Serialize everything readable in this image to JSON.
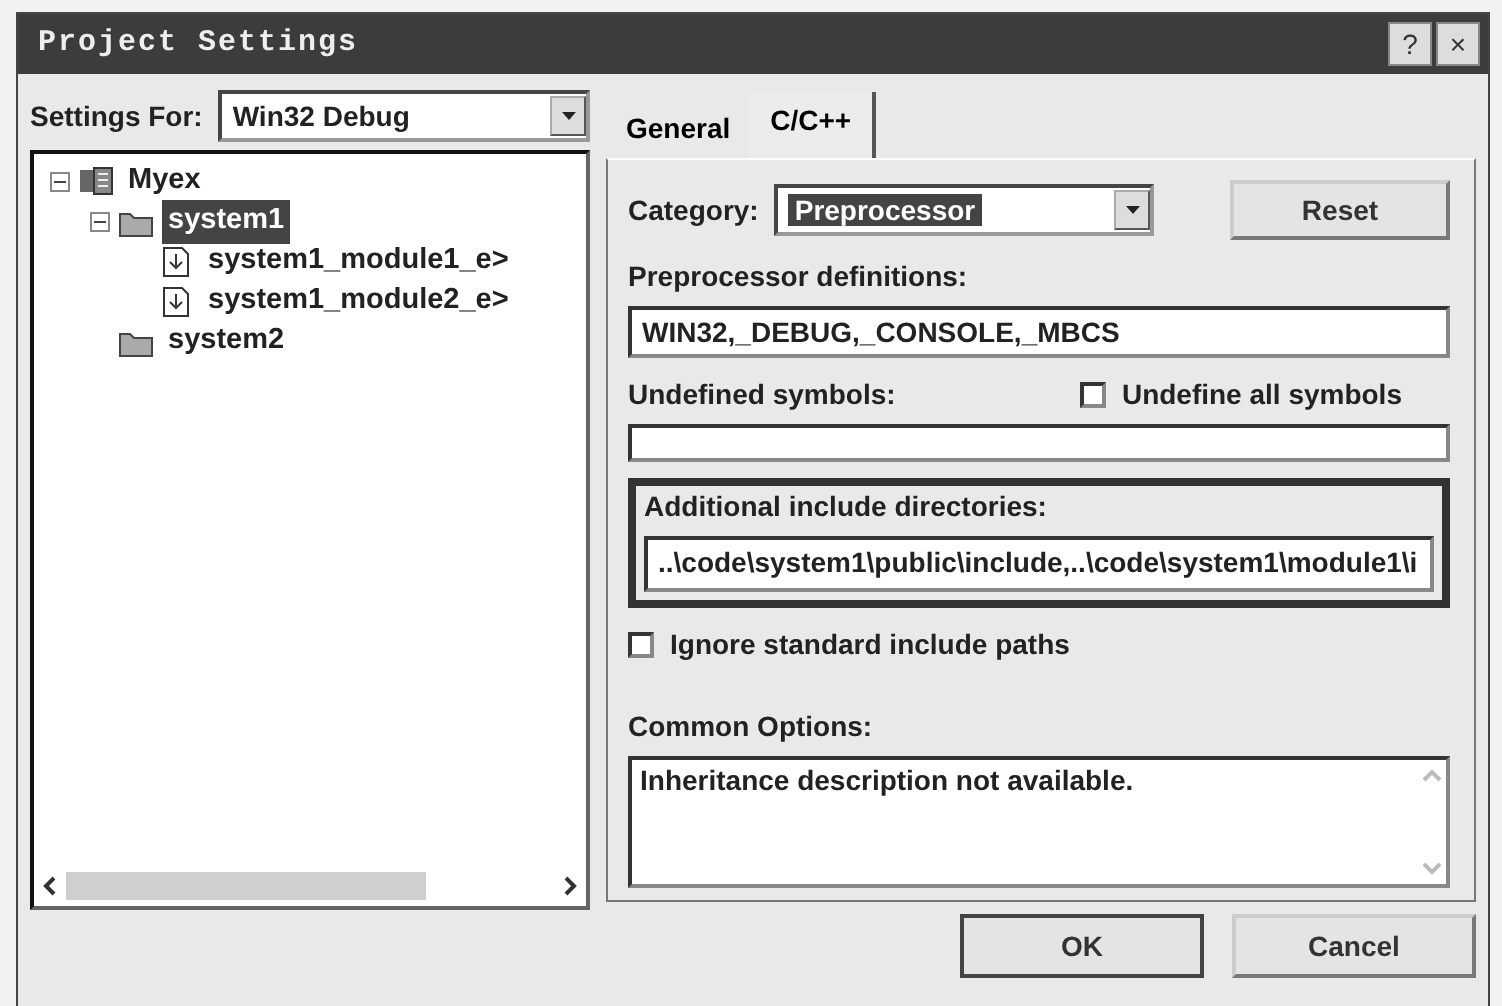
{
  "window": {
    "title": "Project Settings",
    "buttons": [
      "?",
      "×"
    ]
  },
  "settings_for": {
    "label": "Settings For:",
    "value": "Win32 Debug"
  },
  "tree": [
    {
      "label": "Myex",
      "kind": "project",
      "expanded": true,
      "selected": false,
      "children": [
        {
          "label": "system1",
          "kind": "folder",
          "expanded": true,
          "selected": true,
          "children": [
            {
              "label": "system1_module1_e>",
              "kind": "file",
              "selected": false
            },
            {
              "label": "system1_module2_e>",
              "kind": "file",
              "selected": false
            }
          ]
        },
        {
          "label": "system2",
          "kind": "folder",
          "selected": false
        }
      ]
    }
  ],
  "tabs": [
    {
      "label": "General",
      "selected": false
    },
    {
      "label": "C/C++",
      "selected": true
    }
  ],
  "category": {
    "label": "Category:",
    "value": "Preprocessor"
  },
  "reset_button": "Reset",
  "preprocessor_definitions": {
    "label": "Preprocessor definitions:",
    "value": "WIN32,_DEBUG,_CONSOLE,_MBCS"
  },
  "undefined_symbols": {
    "label": "Undefined symbols:"
  },
  "undefine_all": {
    "label": "Undefine all symbols",
    "checked": false
  },
  "additional_include": {
    "label": "Additional include directories:",
    "value": "..\\code\\system1\\public\\include,..\\code\\system1\\module1\\i",
    "highlighted": true
  },
  "ignore_standard": {
    "label": "Ignore standard include paths",
    "checked": false
  },
  "common_options": {
    "label": "Common Options:",
    "value": "Inheritance description not available."
  },
  "buttons": [
    {
      "label": "OK",
      "default": true
    },
    {
      "label": "Cancel",
      "default": false
    }
  ]
}
